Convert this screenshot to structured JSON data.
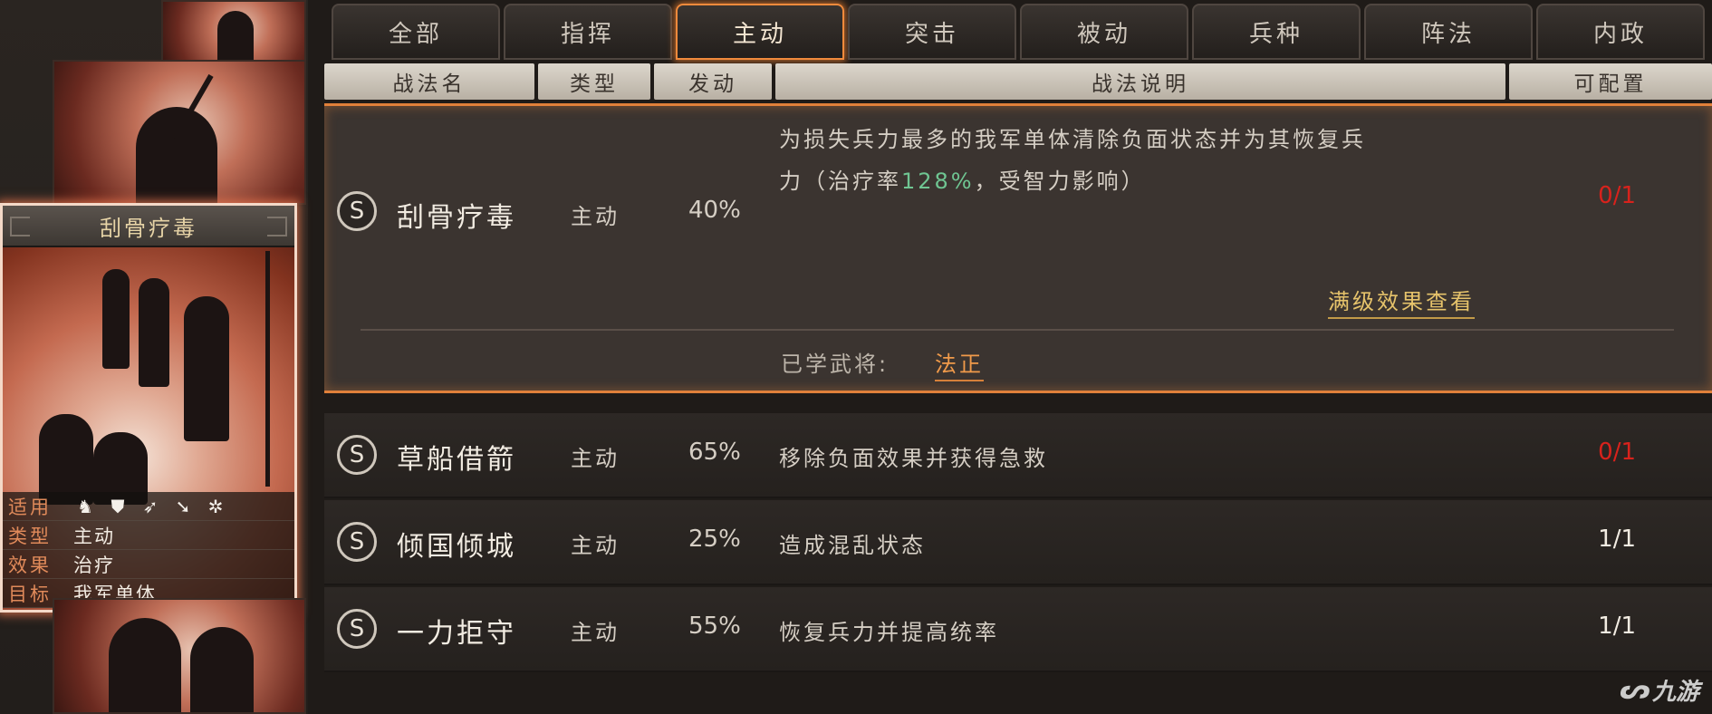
{
  "tabs": [
    "全部",
    "指挥",
    "主动",
    "突击",
    "被动",
    "兵种",
    "阵法",
    "内政"
  ],
  "active_tab_index": 2,
  "columns": {
    "name": "战法名",
    "type": "类型",
    "rate": "发动",
    "desc": "战法说明",
    "config": "可配置"
  },
  "card": {
    "title": "刮骨疗毒",
    "applies_label": "适用",
    "applies_icons": [
      "cavalry-icon",
      "shield-icon",
      "bow-icon",
      "spear-icon",
      "wheel-icon"
    ],
    "type_label": "类型",
    "type_value": "主动",
    "effect_label": "效果",
    "effect_value": "治疗",
    "target_label": "目标",
    "target_value": "我军单体"
  },
  "expanded": {
    "name": "刮骨疗毒",
    "type": "主动",
    "rate": "40%",
    "desc_line1": "为损失兵力最多的我军单体清除负面状态并为其恢复兵",
    "desc_line2_pre": "力（治疗率",
    "desc_heal": "128%",
    "desc_line2_post": "，受智力影响）",
    "count": "0/1",
    "full_effect_link": "满级效果查看",
    "learned_label": "已学武将:",
    "learned_general": "法正"
  },
  "rows": [
    {
      "name": "草船借箭",
      "type": "主动",
      "rate": "65%",
      "desc": "移除负面效果并获得急救",
      "count": "0/1",
      "count_color": "#d8221c"
    },
    {
      "name": "倾国倾城",
      "type": "主动",
      "rate": "25%",
      "desc": "造成混乱状态",
      "count": "1/1",
      "count_color": "#f2ece2"
    },
    {
      "name": "一力拒守",
      "type": "主动",
      "rate": "55%",
      "desc": "恢复兵力并提高统率",
      "count": "1/1",
      "count_color": "#f2ece2"
    }
  ],
  "badge_letter": "S",
  "watermark": "九游"
}
